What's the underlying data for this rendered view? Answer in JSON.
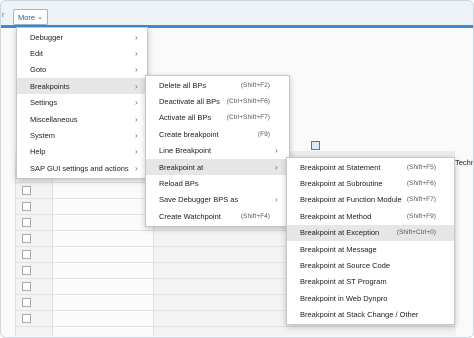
{
  "toolbar": {
    "left_fragment": "r",
    "more_label": "More"
  },
  "background": {
    "column_label": "Techn"
  },
  "menu_main": {
    "items": [
      {
        "label": "Debugger",
        "submenu": true
      },
      {
        "label": "Edit",
        "submenu": true
      },
      {
        "label": "Goto",
        "submenu": true
      },
      {
        "label": "Breakpoints",
        "submenu": true,
        "highlighted": true
      },
      {
        "label": "Settings",
        "submenu": true
      },
      {
        "label": "Miscellaneous",
        "submenu": true
      },
      {
        "label": "System",
        "submenu": true
      },
      {
        "label": "Help",
        "submenu": true
      },
      {
        "label": "SAP GUI settings and actions",
        "submenu": true
      }
    ]
  },
  "menu_breakpoints": {
    "items": [
      {
        "label": "Delete all BPs",
        "shortcut": "(Shift+F2)"
      },
      {
        "label": "Deactivate all BPs",
        "shortcut": "(Ctrl+Shift+F6)"
      },
      {
        "label": "Activate all BPs",
        "shortcut": "(Ctrl+Shift+F7)"
      },
      {
        "label": "Create breakpoint",
        "shortcut": "(F9)"
      },
      {
        "label": "Line Breakpoint",
        "submenu": true
      },
      {
        "label": "Breakpoint at",
        "submenu": true,
        "highlighted": true
      },
      {
        "label": "Reload BPs"
      },
      {
        "label": "Save Debugger BPS as",
        "submenu": true
      },
      {
        "label": "Create Watchpoint",
        "shortcut": "(Shift+F4)"
      }
    ]
  },
  "menu_breakpoint_at": {
    "items": [
      {
        "label": "Breakpoint at Statement",
        "shortcut": "(Shift+F5)"
      },
      {
        "label": "Breakpoint at Subroutine",
        "shortcut": "(Shift+F6)"
      },
      {
        "label": "Breakpoint at Function Module",
        "shortcut": "(Shift+F7)"
      },
      {
        "label": "Breakpoint at Method",
        "shortcut": "(Shift+F9)"
      },
      {
        "label": "Breakpoint at Exception",
        "shortcut": "(Shift+Ctrl+0)",
        "highlighted": true
      },
      {
        "label": "Breakpoint at Message"
      },
      {
        "label": "Breakpoint at Source Code"
      },
      {
        "label": "Breakpoint at ST Program"
      },
      {
        "label": "Breakpoint in Web Dynpro"
      },
      {
        "label": "Breakpoint at Stack Change / Other"
      }
    ]
  },
  "icons": {
    "submenu_arrow": "chevron-right-icon",
    "more_chevron": "chevron-down-icon"
  }
}
